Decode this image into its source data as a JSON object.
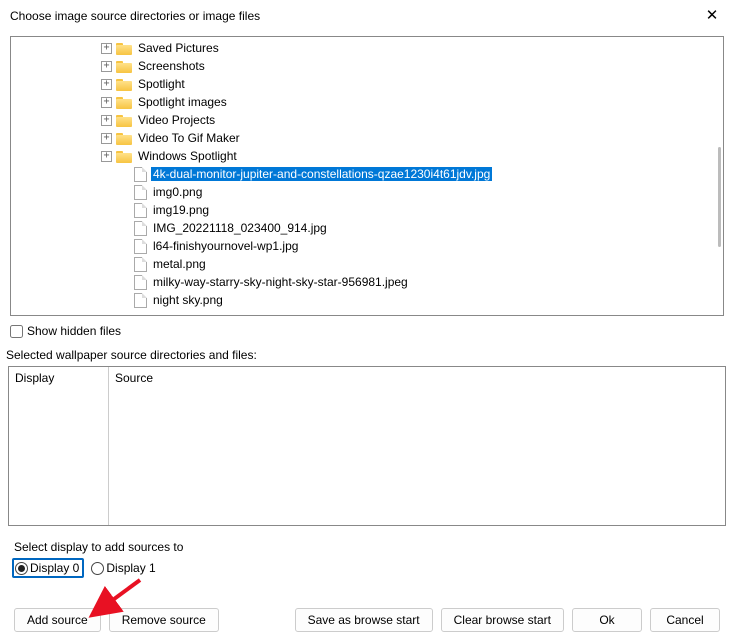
{
  "title": "Choose image source directories or image files",
  "tree": {
    "folders": [
      {
        "label": "Saved Pictures",
        "expandable": true
      },
      {
        "label": "Screenshots",
        "expandable": true
      },
      {
        "label": "Spotlight",
        "expandable": true
      },
      {
        "label": "Spotlight images",
        "expandable": true
      },
      {
        "label": "Video Projects",
        "expandable": true
      },
      {
        "label": "Video To Gif Maker",
        "expandable": true
      },
      {
        "label": "Windows Spotlight",
        "expandable": true
      }
    ],
    "files": [
      {
        "label": "4k-dual-monitor-jupiter-and-constellations-qzae1230i4t61jdv.jpg",
        "selected": true
      },
      {
        "label": "img0.png"
      },
      {
        "label": "img19.png"
      },
      {
        "label": "IMG_20221118_023400_914.jpg"
      },
      {
        "label": "l64-finishyournovel-wp1.jpg"
      },
      {
        "label": "metal.png"
      },
      {
        "label": "milky-way-starry-sky-night-sky-star-956981.jpeg"
      },
      {
        "label": "night sky.png"
      }
    ]
  },
  "show_hidden_label": "Show hidden files",
  "selected_sources_label": "Selected wallpaper source directories and files:",
  "sources_headers": {
    "display": "Display",
    "source": "Source"
  },
  "select_display_label": "Select display to add sources to",
  "radios": {
    "d0": "Display 0",
    "d1": "Display 1"
  },
  "buttons": {
    "add": "Add source",
    "remove": "Remove source",
    "save": "Save as browse start",
    "clear": "Clear browse start",
    "ok": "Ok",
    "cancel": "Cancel"
  }
}
